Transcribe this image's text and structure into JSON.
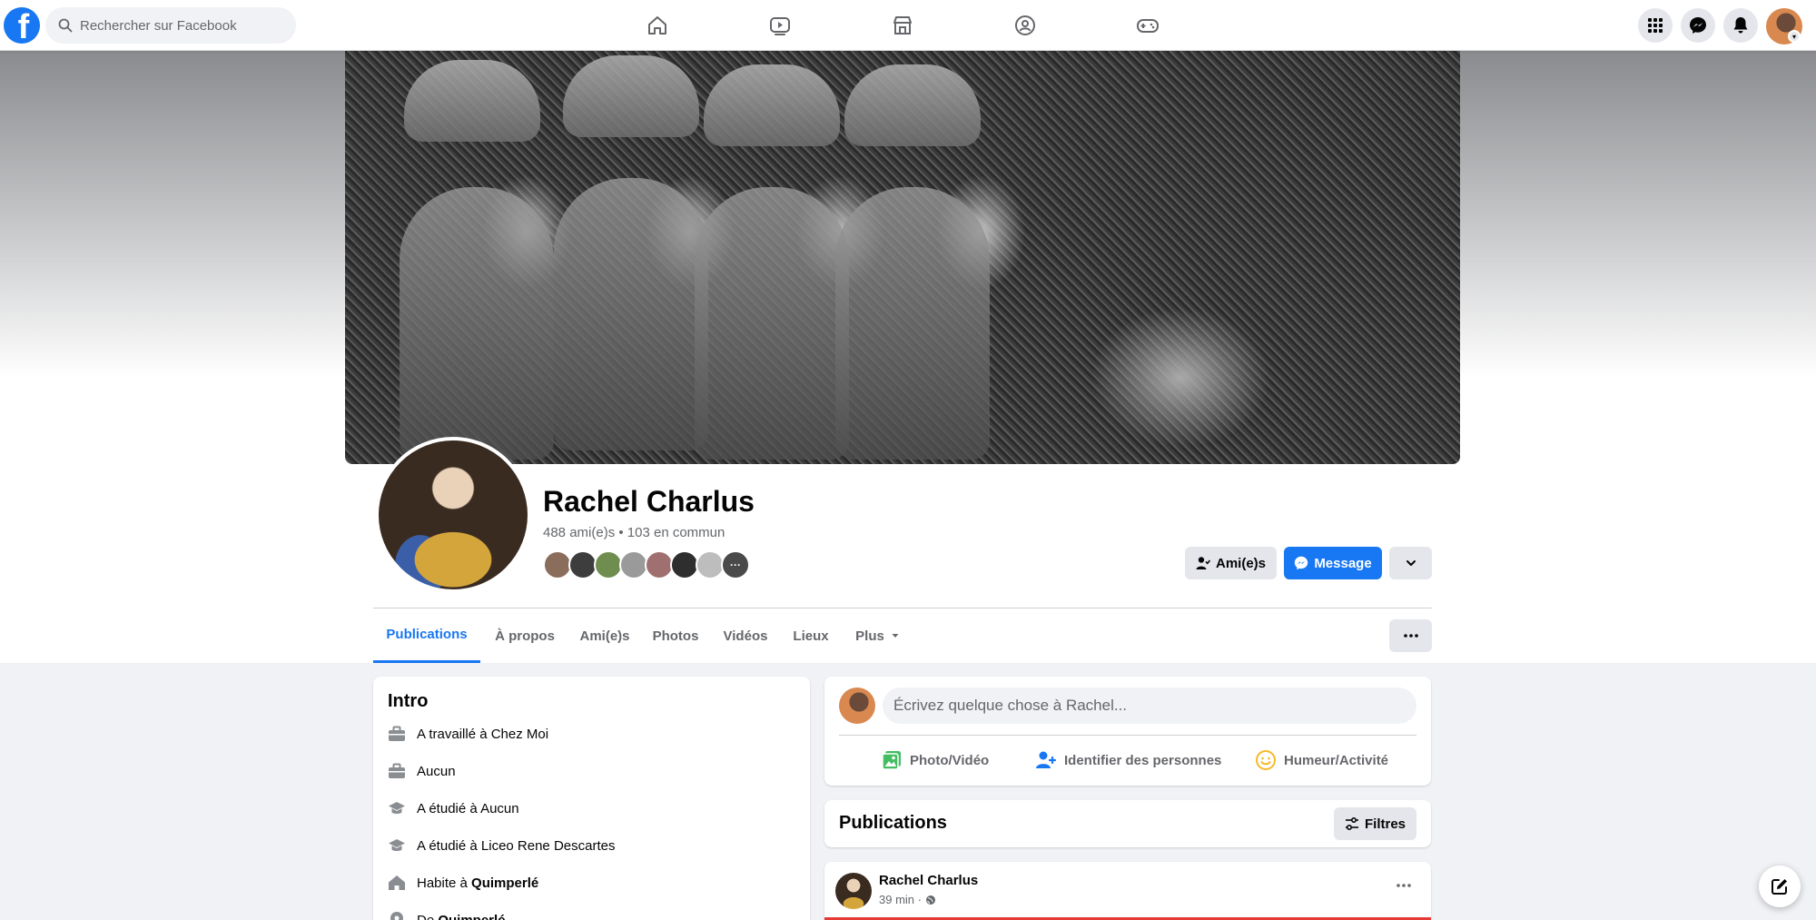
{
  "search": {
    "placeholder": "Rechercher sur Facebook"
  },
  "nav": {
    "icons": [
      "home-icon",
      "watch-icon",
      "marketplace-icon",
      "groups-icon",
      "gaming-icon"
    ],
    "right_icons": [
      "menu-grid-icon",
      "messenger-icon",
      "notifications-icon"
    ]
  },
  "profile": {
    "name": "Rachel Charlus",
    "friends_summary": "488 ami(e)s • 103 en commun",
    "buttons": {
      "friends": "Ami(e)s",
      "message": "Message"
    }
  },
  "tabs": [
    {
      "label": "Publications",
      "active": true
    },
    {
      "label": "À propos"
    },
    {
      "label": "Ami(e)s"
    },
    {
      "label": "Photos"
    },
    {
      "label": "Vidéos"
    },
    {
      "label": "Lieux"
    },
    {
      "label": "Plus"
    }
  ],
  "intro": {
    "title": "Intro",
    "items": [
      {
        "icon": "briefcase-icon",
        "text": "A travaillé à Chez Moi"
      },
      {
        "icon": "briefcase-icon",
        "text": "Aucun"
      },
      {
        "icon": "graduation-cap-icon",
        "text": "A étudié à Aucun"
      },
      {
        "icon": "graduation-cap-icon",
        "text": "A étudié à Liceo Rene Descartes"
      },
      {
        "icon": "home-icon",
        "prefix": "Habite à ",
        "strong": "Quimperlé"
      },
      {
        "icon": "location-pin-icon",
        "prefix": "De ",
        "strong": "Quimperlé"
      }
    ]
  },
  "composer": {
    "placeholder": "Écrivez quelque chose à Rachel...",
    "actions": [
      "Photo/Vidéo",
      "Identifier des personnes",
      "Humeur/Activité"
    ]
  },
  "posts_header": {
    "title": "Publications",
    "filters": "Filtres"
  },
  "post": {
    "author": "Rachel Charlus",
    "time": "39 min ·"
  },
  "colors": {
    "accent": "#1877f2",
    "text_secondary": "#65676b",
    "bg": "#f0f2f5"
  }
}
